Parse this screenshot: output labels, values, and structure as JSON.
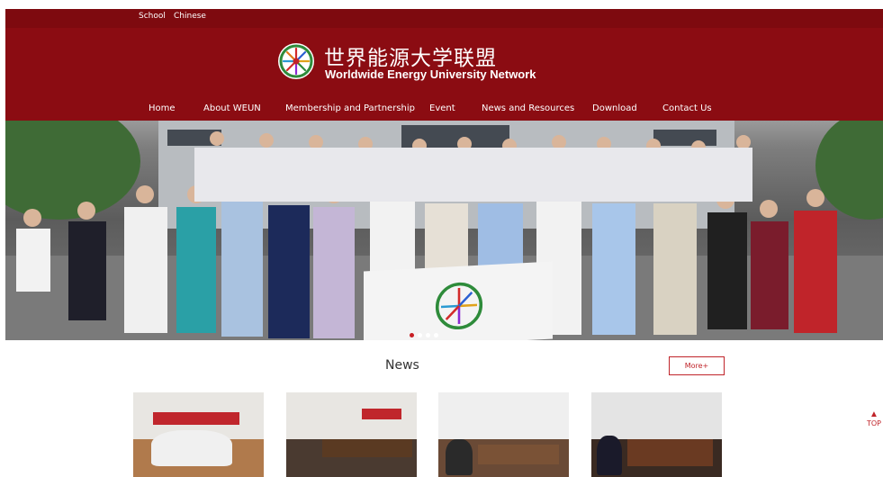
{
  "topbar": {
    "school": "School",
    "chinese": "Chinese"
  },
  "header": {
    "logo_icon": "wewun-wheel-logo",
    "title_cn": "世界能源大学联盟",
    "title_en": "Worldwide Energy University Network"
  },
  "nav": [
    {
      "label": "Home"
    },
    {
      "label": "About WEUN"
    },
    {
      "label": "Membership and Partnership"
    },
    {
      "label": "Event"
    },
    {
      "label": "News and Resources"
    },
    {
      "label": "Download"
    },
    {
      "label": "Contact Us"
    }
  ],
  "banner": {
    "slides": 4,
    "active_slide": 1
  },
  "news": {
    "title": "News",
    "more_label": "More+"
  },
  "top_button": {
    "icon": "chevron-up-icon",
    "label": "TOP"
  },
  "colors": {
    "brand": "#8b0c12",
    "topbar": "#7e0a0f",
    "accent": "#c0242a"
  }
}
